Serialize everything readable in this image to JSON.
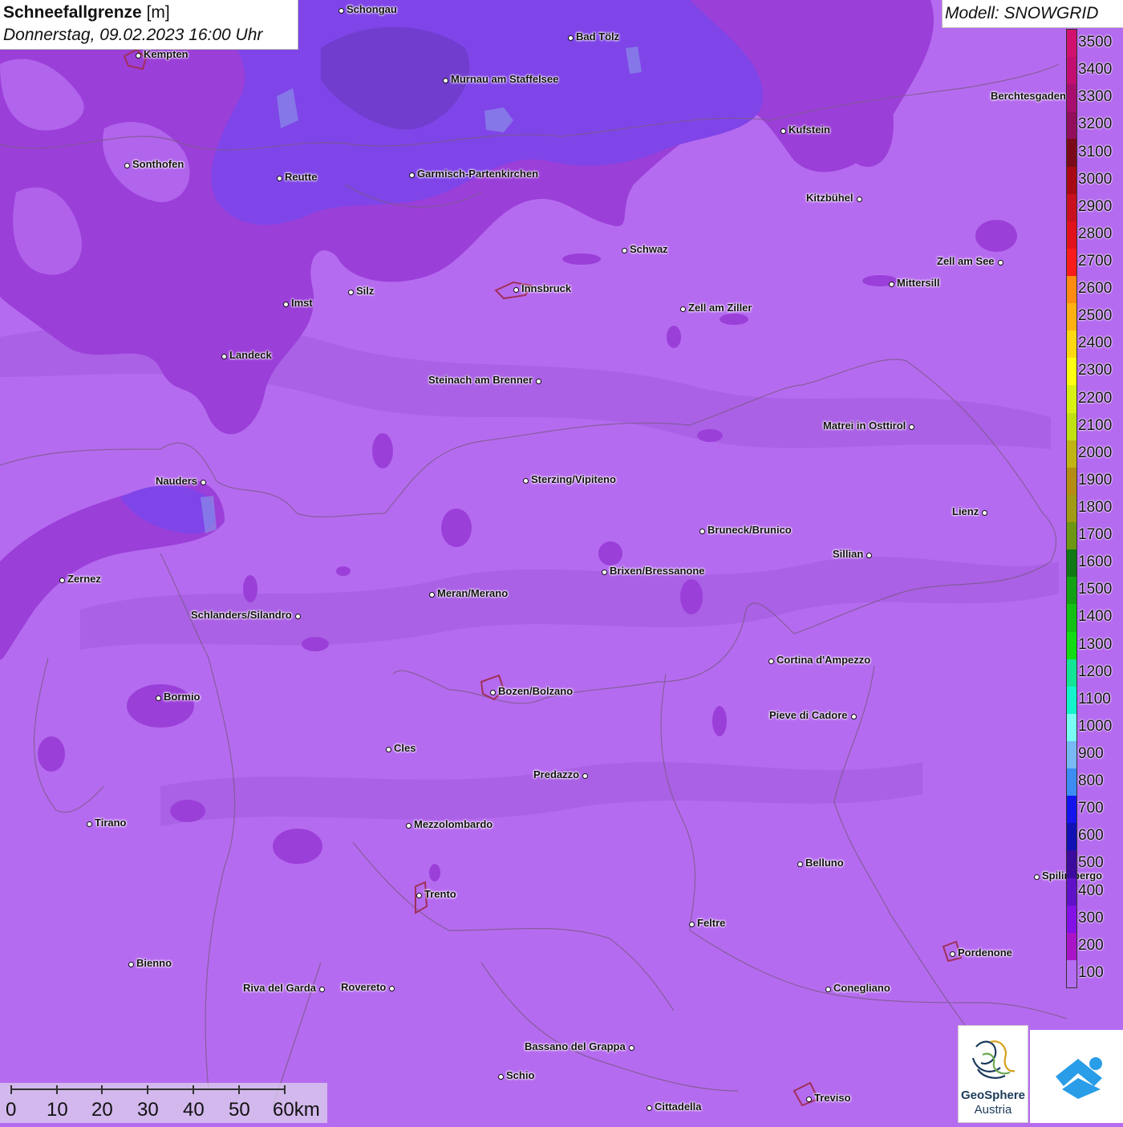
{
  "header": {
    "title_bold": "Schneefallgrenze",
    "title_unit": "[m]",
    "datetime": "Donnerstag, 09.02.2023 16:00 Uhr"
  },
  "model_label": "Modell: SNOWGRID",
  "legend": {
    "labels": [
      "3500",
      "3400",
      "3300",
      "3200",
      "3100",
      "3000",
      "2900",
      "2800",
      "2700",
      "2600",
      "2500",
      "2400",
      "2300",
      "2200",
      "2100",
      "2000",
      "1900",
      "1800",
      "1700",
      "1600",
      "1500",
      "1400",
      "1300",
      "1200",
      "1100",
      "1000",
      "900",
      "800",
      "700",
      "600",
      "500",
      "400",
      "300",
      "200",
      "100"
    ],
    "colors": [
      "#d2106e",
      "#c10e70",
      "#a80e6e",
      "#920e5c",
      "#7a0a1a",
      "#a80a14",
      "#c8101e",
      "#e0121c",
      "#f81c1c",
      "#ff8a14",
      "#ffb014",
      "#ffd814",
      "#ffff14",
      "#d8f014",
      "#c0e014",
      "#c0b414",
      "#b48c14",
      "#a09a14",
      "#6c9614",
      "#107814",
      "#14a014",
      "#14c014",
      "#14dc14",
      "#14e496",
      "#14f4cc",
      "#78fcf4",
      "#78b8f4",
      "#3c8cf4",
      "#1414ec",
      "#1010b4",
      "#3c0a9c",
      "#6010c8",
      "#8410e8",
      "#aa14c8",
      "#b46cf0"
    ]
  },
  "scale": {
    "labels": [
      "0",
      "10",
      "20",
      "30",
      "40",
      "50",
      "60km"
    ]
  },
  "logos": {
    "geosphere_line1": "GeoSphere",
    "geosphere_line2": "Austria"
  },
  "cities": [
    {
      "name": "Schongau"
    },
    {
      "name": "Kempten"
    },
    {
      "name": "Bad Tölz"
    },
    {
      "name": "Murnau am Staffelsee"
    },
    {
      "name": "Sonthofen"
    },
    {
      "name": "Reutte"
    },
    {
      "name": "Garmisch-Partenkirchen"
    },
    {
      "name": "Kufstein"
    },
    {
      "name": "Berchtesgaden"
    },
    {
      "name": "Kitzbühel"
    },
    {
      "name": "Schwaz"
    },
    {
      "name": "Zell am See"
    },
    {
      "name": "Innsbruck"
    },
    {
      "name": "Mittersill"
    },
    {
      "name": "Imst"
    },
    {
      "name": "Silz"
    },
    {
      "name": "Zell am Ziller"
    },
    {
      "name": "Landeck"
    },
    {
      "name": "Steinach am Brenner"
    },
    {
      "name": "Matrei in Osttirol"
    },
    {
      "name": "Nauders"
    },
    {
      "name": "Sterzing/Vipiteno"
    },
    {
      "name": "Lienz"
    },
    {
      "name": "Bruneck/Brunico"
    },
    {
      "name": "Sillian"
    },
    {
      "name": "Zernez"
    },
    {
      "name": "Brixen/Bressanone"
    },
    {
      "name": "Meran/Merano"
    },
    {
      "name": "Schlanders/Silandro"
    },
    {
      "name": "Cortina d'Ampezzo"
    },
    {
      "name": "Bozen/Bolzano"
    },
    {
      "name": "Bormio"
    },
    {
      "name": "Pieve di Cadore"
    },
    {
      "name": "Cles"
    },
    {
      "name": "Predazzo"
    },
    {
      "name": "Tirano"
    },
    {
      "name": "Mezzolombardo"
    },
    {
      "name": "Belluno"
    },
    {
      "name": "Spilimbergo"
    },
    {
      "name": "Trento"
    },
    {
      "name": "Feltre"
    },
    {
      "name": "Pordenone"
    },
    {
      "name": "Bienno"
    },
    {
      "name": "Riva del Garda"
    },
    {
      "name": "Rovereto"
    },
    {
      "name": "Conegliano"
    },
    {
      "name": "Bassano del Grappa"
    },
    {
      "name": "Schio"
    },
    {
      "name": "Treviso"
    },
    {
      "name": "Cittadella"
    }
  ]
}
